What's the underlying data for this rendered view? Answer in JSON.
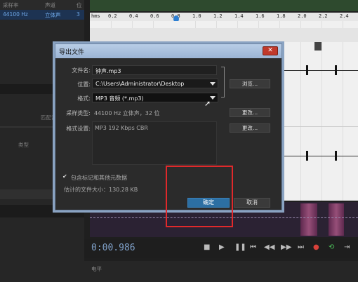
{
  "left_panel": {
    "columns": [
      "采样率",
      "声道",
      "位"
    ],
    "row": {
      "sample_rate": "44100 Hz",
      "channels": "立体声",
      "bits": "3"
    },
    "mid_text": "匹配音量",
    "list_header": "类型"
  },
  "editor": {
    "ruler_label": "hms",
    "ruler_ticks": [
      "0.2",
      "0.4",
      "0.6",
      "0.8",
      "1.0",
      "1.2",
      "1.4",
      "1.6",
      "1.8",
      "2.0",
      "2.2",
      "2.4"
    ],
    "playhead_time": "1.0"
  },
  "transport": {
    "time": "0:00.986",
    "buttons": [
      "stop",
      "play",
      "pause",
      "to-start",
      "rewind",
      "fast-forward",
      "to-end",
      "record",
      "loop",
      "skip"
    ]
  },
  "bottom_bar": {
    "label": "电平"
  },
  "dialog": {
    "title": "导出文件",
    "close_label": "✕",
    "filename_label": "文件名:",
    "filename_value": "钟声.mp3",
    "location_label": "位置:",
    "location_value": "C:\\Users\\Administrator\\Desktop",
    "browse_label": "浏览...",
    "format_label": "格式:",
    "format_value": "MP3 音频 (*.mp3)",
    "sample_type_label": "采样类型:",
    "sample_type_value": "44100 Hz 立体声，32 位",
    "change_label_1": "更改...",
    "format_settings_label": "格式设置:",
    "format_settings_value": "MP3 192 Kbps CBR",
    "change_label_2": "更改...",
    "include_markers_label": "包含标记和其他元数据",
    "include_markers_checked": true,
    "estimated_size": "估计的文件大小：130.28 KB",
    "ok_label": "确定",
    "cancel_label": "取消"
  },
  "colors": {
    "accent": "#2c6fa3",
    "highlight": "#e0292b",
    "title_bar": "#9bb4d4"
  }
}
